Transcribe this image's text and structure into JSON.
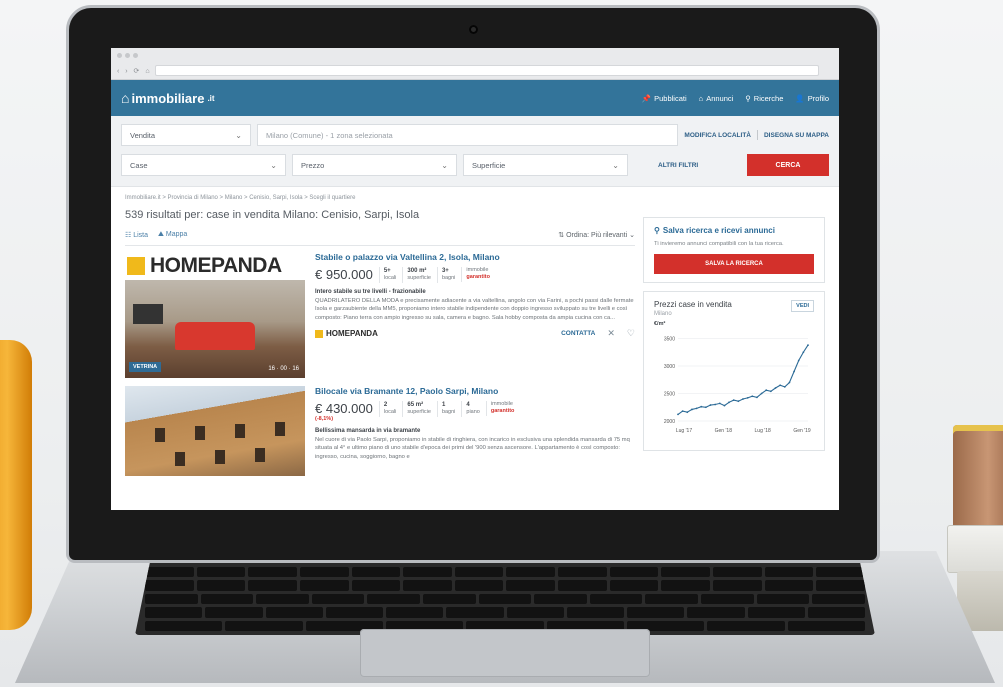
{
  "site": {
    "brand": "immobiliare",
    "brand_suffix": ".it",
    "nav": [
      {
        "icon": "pin-icon",
        "label": "Pubblicati"
      },
      {
        "icon": "home-icon",
        "label": "Annunci"
      },
      {
        "icon": "search-icon",
        "label": "Ricerche"
      },
      {
        "icon": "user-icon",
        "label": "Profilo"
      }
    ]
  },
  "search": {
    "contract": "Vendita",
    "location": "Milano (Comune) - 1 zona selezionata",
    "edit_location": "MODIFICA LOCALITÀ",
    "draw_map": "DISEGNA SU MAPPA",
    "type": "Case",
    "price": "Prezzo",
    "surface": "Superficie",
    "more_filters": "ALTRI FILTRI",
    "submit": "CERCA"
  },
  "results": {
    "breadcrumb": "Immobiliare.it > Provincia di Milano > Milano > Cenisio, Sarpi, Isola > Scegli il quartiere",
    "title": "539 risultati per: case in vendita Milano: Cenisio, Sarpi, Isola",
    "view_list": "Lista",
    "view_map": "Mappa",
    "order": "Ordina: Più rilevanti"
  },
  "listings": [
    {
      "photo_brand": "HOMEPANDA",
      "badge": "VETRINA",
      "photo_counts": "16 · 00 · 16",
      "title": "Stabile o palazzo via Valtellina 2, Isola, Milano",
      "price": "€ 950.000",
      "features": [
        {
          "value": "5+",
          "label": "locali"
        },
        {
          "value": "300 m²",
          "label": "superficie"
        },
        {
          "value": "3+",
          "label": "bagni"
        },
        {
          "value": "immobile",
          "label": "garantito",
          "red": true
        }
      ],
      "subtitle": "Intero stabile su tre livelli - frazionabile",
      "description": "QUADRILATERO DELLA MODA e precisamente adiacente a via valtellina, angolo con via Farini, a pochi passi dalle fermate Isola e garzaubiente della MM5, proponiamo intero stabile indipendente con doppio ingresso sviluppato su tre livelli e così composto: Piano terra con ampio ingresso su sala, camera e bagno. Sala hobby composta da ampia cucina con ca...",
      "agency": "HOMEPANDA",
      "contact": "CONTATTA"
    },
    {
      "title": "Bilocale via Bramante 12, Paolo Sarpi, Milano",
      "price": "€ 430.000",
      "price_note": "(-8,1%)",
      "features": [
        {
          "value": "2",
          "label": "locali"
        },
        {
          "value": "65 m²",
          "label": "superficie"
        },
        {
          "value": "1",
          "label": "bagni"
        },
        {
          "value": "4",
          "label": "piano"
        },
        {
          "value": "immobile",
          "label": "garantito",
          "red": true
        }
      ],
      "subtitle": "Bellissima mansarda in via bramante",
      "description": "Nel cuore di via Paolo Sarpi, proponiamo in stabile di ringhiera, con incarico in esclusiva una splendida mansarda di 75 mq situata al 4° e ultimo piano di uno stabile d'epoca dei primi del '900 senza ascensore. L'appartamento è così composto: ingresso, cucina, soggiorno, bagno e"
    }
  ],
  "sidebar": {
    "save_title": "Salva ricerca e ricevi annunci",
    "save_text": "Ti invieremo annunci compatibili con la tua ricerca.",
    "save_button": "SALVA LA RICERCA",
    "prices_title": "Prezzi case in vendita",
    "prices_city": "Milano",
    "see": "VEDI"
  },
  "chart_data": {
    "type": "line",
    "title": "Prezzi case in vendita",
    "ylabel": "€/m²",
    "x_ticks": [
      "Lug '17",
      "Gen '18",
      "Lug '18",
      "Gen '19"
    ],
    "y_ticks": [
      2000,
      2500,
      3000,
      3500
    ],
    "ylim": [
      2000,
      3600
    ],
    "series": [
      {
        "values": [
          2120,
          2180,
          2160,
          2210,
          2230,
          2260,
          2250,
          2290,
          2300,
          2320,
          2280,
          2340,
          2380,
          2360,
          2400,
          2420,
          2450,
          2430,
          2500,
          2560,
          2540,
          2600,
          2650,
          2620,
          2700,
          2900,
          3100,
          3250,
          3380
        ]
      }
    ],
    "grid": true
  }
}
